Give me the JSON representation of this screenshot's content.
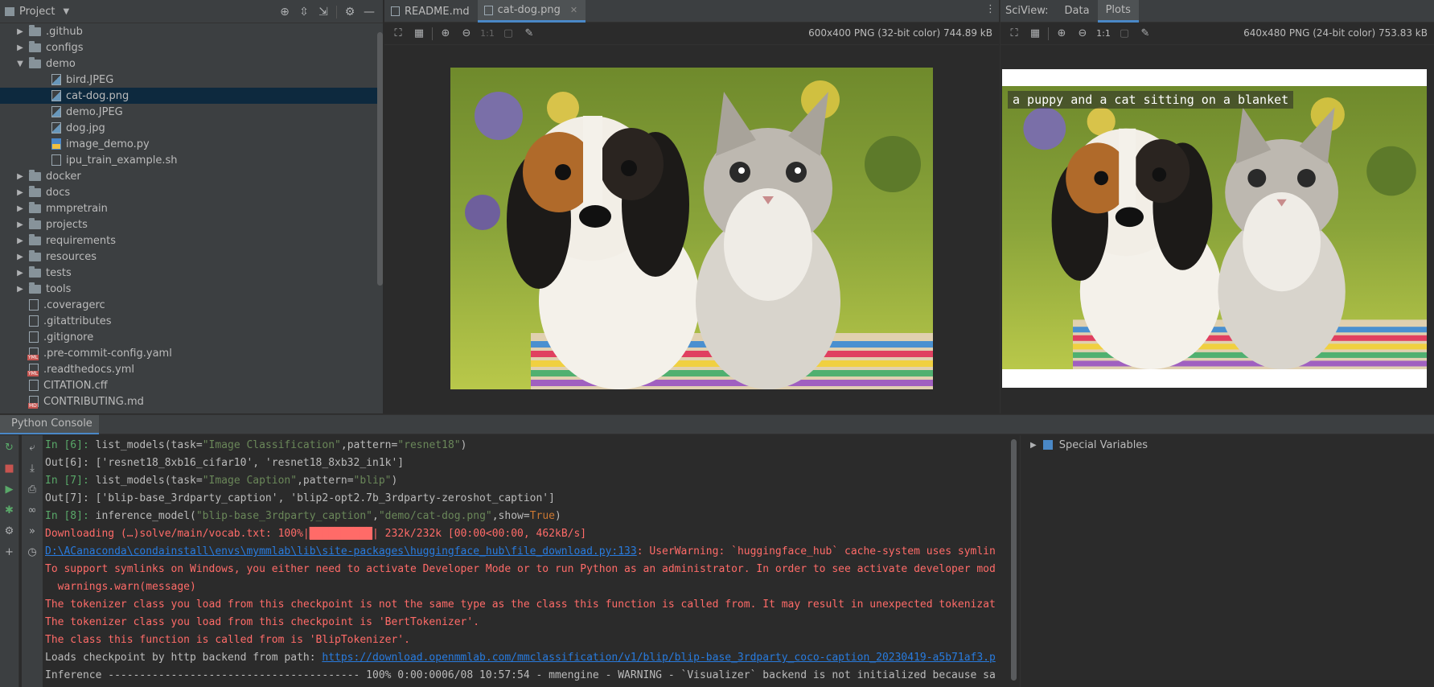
{
  "project": {
    "title": "Project",
    "tree": [
      {
        "label": ".github",
        "type": "folder",
        "level": 1,
        "state": "collapsed"
      },
      {
        "label": "configs",
        "type": "folder",
        "level": 1,
        "state": "collapsed"
      },
      {
        "label": "demo",
        "type": "folder",
        "level": 1,
        "state": "expanded"
      },
      {
        "label": "bird.JPEG",
        "type": "img",
        "level": 2
      },
      {
        "label": "cat-dog.png",
        "type": "img",
        "level": 2,
        "selected": true
      },
      {
        "label": "demo.JPEG",
        "type": "img",
        "level": 2
      },
      {
        "label": "dog.jpg",
        "type": "img",
        "level": 2
      },
      {
        "label": "image_demo.py",
        "type": "py",
        "level": 2
      },
      {
        "label": "ipu_train_example.sh",
        "type": "file",
        "level": 2
      },
      {
        "label": "docker",
        "type": "folder",
        "level": 1,
        "state": "collapsed"
      },
      {
        "label": "docs",
        "type": "folder",
        "level": 1,
        "state": "collapsed"
      },
      {
        "label": "mmpretrain",
        "type": "folder",
        "level": 1,
        "state": "collapsed"
      },
      {
        "label": "projects",
        "type": "folder",
        "level": 1,
        "state": "collapsed"
      },
      {
        "label": "requirements",
        "type": "folder",
        "level": 1,
        "state": "collapsed"
      },
      {
        "label": "resources",
        "type": "folder",
        "level": 1,
        "state": "collapsed"
      },
      {
        "label": "tests",
        "type": "folder",
        "level": 1,
        "state": "collapsed"
      },
      {
        "label": "tools",
        "type": "folder",
        "level": 1,
        "state": "collapsed"
      },
      {
        "label": ".coveragerc",
        "type": "file",
        "level": 1
      },
      {
        "label": ".gitattributes",
        "type": "file",
        "level": 1
      },
      {
        "label": ".gitignore",
        "type": "file",
        "level": 1
      },
      {
        "label": ".pre-commit-config.yaml",
        "type": "yml",
        "level": 1
      },
      {
        "label": ".readthedocs.yml",
        "type": "yml",
        "level": 1
      },
      {
        "label": "CITATION.cff",
        "type": "file",
        "level": 1
      },
      {
        "label": "CONTRIBUTING.md",
        "type": "md",
        "level": 1
      }
    ]
  },
  "editor": {
    "tabs": [
      {
        "label": "README.md",
        "active": false
      },
      {
        "label": "cat-dog.png",
        "active": true
      }
    ],
    "zoom_label": "1:1",
    "image_info": "600x400 PNG (32-bit color) 744.89 kB"
  },
  "sciview": {
    "label": "SciView:",
    "tabs": [
      {
        "label": "Data",
        "active": false
      },
      {
        "label": "Plots",
        "active": true
      }
    ],
    "zoom_label": "1:1",
    "image_info": "640x480 PNG (24-bit color) 753.83 kB",
    "caption": "a puppy and a cat sitting on a blanket"
  },
  "console": {
    "title": "Python Console",
    "lines": {
      "l1_prompt": "In [6]: ",
      "l1_code_a": "list_models(task=",
      "l1_str_a": "\"Image Classification\"",
      "l1_code_b": ",pattern=",
      "l1_str_b": "\"resnet18\"",
      "l1_code_c": ")",
      "l2": "Out[6]: ['resnet18_8xb16_cifar10', 'resnet18_8xb32_in1k']",
      "l3_prompt": "In [7]: ",
      "l3_code_a": "list_models(task=",
      "l3_str_a": "\"Image Caption\"",
      "l3_code_b": ",pattern=",
      "l3_str_b": "\"blip\"",
      "l3_code_c": ")",
      "l4": "Out[7]: ['blip-base_3rdparty_caption', 'blip2-opt2.7b_3rdparty-zeroshot_caption']",
      "l5_prompt": "In [8]: ",
      "l5_code_a": "inference_model(",
      "l5_str_a": "\"blip-base_3rdparty_caption\"",
      "l5_code_b": ",",
      "l5_str_b": "\"demo/cat-dog.png\"",
      "l5_code_c": ",show=",
      "l5_kw": "True",
      "l5_code_d": ")",
      "l6_a": "Downloading (…)solve/main/vocab.txt: 100%|",
      "l6_bar": "██████████",
      "l6_b": "| 232k/232k [00:00<00:00, 462kB/s]",
      "l7_link": "D:\\ACanaconda\\condainstall\\envs\\mymmlab\\lib\\site-packages\\huggingface_hub\\file_download.py:133",
      "l7_rest": ": UserWarning: `huggingface_hub` cache-system uses symlin",
      "l8": "To support symlinks on Windows, you either need to activate Developer Mode or to run Python as an administrator. In order to see activate developer mod",
      "l9": "  warnings.warn(message)",
      "l10": "The tokenizer class you load from this checkpoint is not the same type as the class this function is called from. It may result in unexpected tokenizat",
      "l11": "The tokenizer class you load from this checkpoint is 'BertTokenizer'.",
      "l12": "The class this function is called from is 'BlipTokenizer'.",
      "l13_a": "Loads checkpoint by http backend from path: ",
      "l13_link": "https://download.openmmlab.com/mmclassification/v1/blip/blip-base_3rdparty_coco-caption_20230419-a5b71af3.p",
      "l14": "Inference ---------------------------------------- 100% 0:00:0006/08 10:57:54 - mmengine - WARNING - `Visualizer` backend is not initialized because sa"
    },
    "variables_label": "Special Variables"
  }
}
